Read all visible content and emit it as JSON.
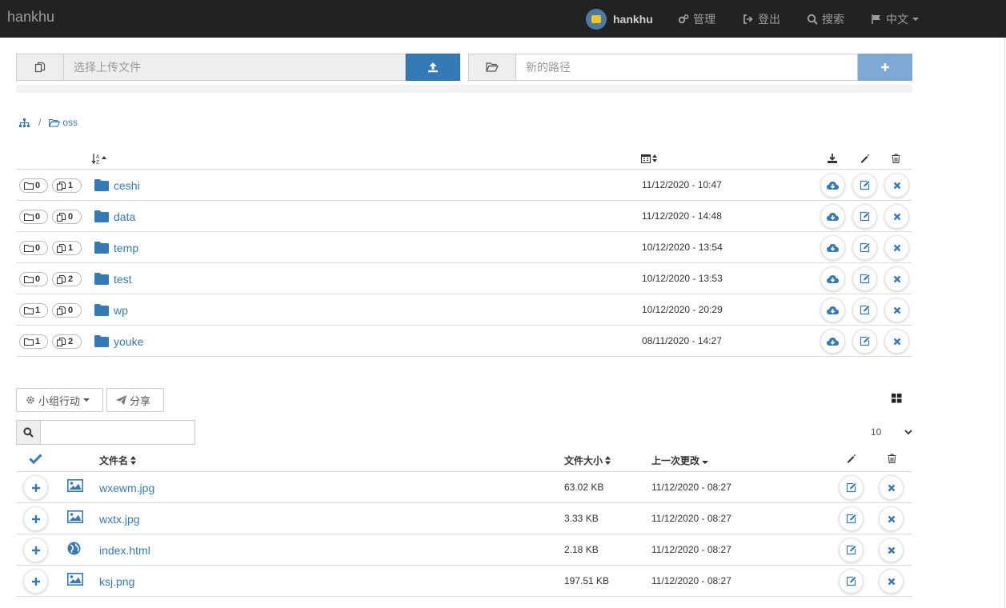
{
  "navbar": {
    "brand": "hankhu",
    "user": "hankhu",
    "admin": "管理",
    "logout": "登出",
    "search": "搜索",
    "language": "中文"
  },
  "upload": {
    "placeholder": "选择上传文件",
    "progress_percent": 0
  },
  "new_path": {
    "placeholder": "新的路径",
    "value": ""
  },
  "breadcrumb": {
    "root_icon": "sitemap-icon",
    "separator": "/",
    "current": "oss"
  },
  "folders": [
    {
      "name": "ceshi",
      "folder_count": "0",
      "file_count": "1",
      "date": "11/12/2020 - 10:47"
    },
    {
      "name": "data",
      "folder_count": "0",
      "file_count": "0",
      "date": "11/12/2020 - 14:48"
    },
    {
      "name": "temp",
      "folder_count": "0",
      "file_count": "1",
      "date": "10/12/2020 - 13:54"
    },
    {
      "name": "test",
      "folder_count": "0",
      "file_count": "2",
      "date": "10/12/2020 - 13:53"
    },
    {
      "name": "wp",
      "folder_count": "1",
      "file_count": "0",
      "date": "10/12/2020 - 20:29"
    },
    {
      "name": "youke",
      "folder_count": "1",
      "file_count": "2",
      "date": "08/11/2020 - 14:27"
    }
  ],
  "file_toolbar": {
    "group_action": "小组行动",
    "share": "分享",
    "page_size": "10",
    "search_value": ""
  },
  "file_table": {
    "headers": {
      "name": "文件名",
      "size": "文件大小",
      "modified": "上一次更改"
    },
    "rows": [
      {
        "name": "wxewm.jpg",
        "type_icon": "image-icon",
        "size": "63.02 KB",
        "modified": "11/12/2020 - 08:27"
      },
      {
        "name": "wxtx.jpg",
        "type_icon": "image-icon",
        "size": "3.33 KB",
        "modified": "11/12/2020 - 08:27"
      },
      {
        "name": "index.html",
        "type_icon": "globe-icon",
        "size": "2.18 KB",
        "modified": "11/12/2020 - 08:27"
      },
      {
        "name": "ksj.png",
        "type_icon": "image-icon",
        "size": "197.51 KB",
        "modified": "11/12/2020 - 08:27"
      }
    ]
  },
  "colors": {
    "navbar_bg": "#222222",
    "primary": "#337ab7",
    "primary_disabled": "#7ea9d4",
    "link": "#337ab7",
    "row_border": "#dddddd"
  }
}
